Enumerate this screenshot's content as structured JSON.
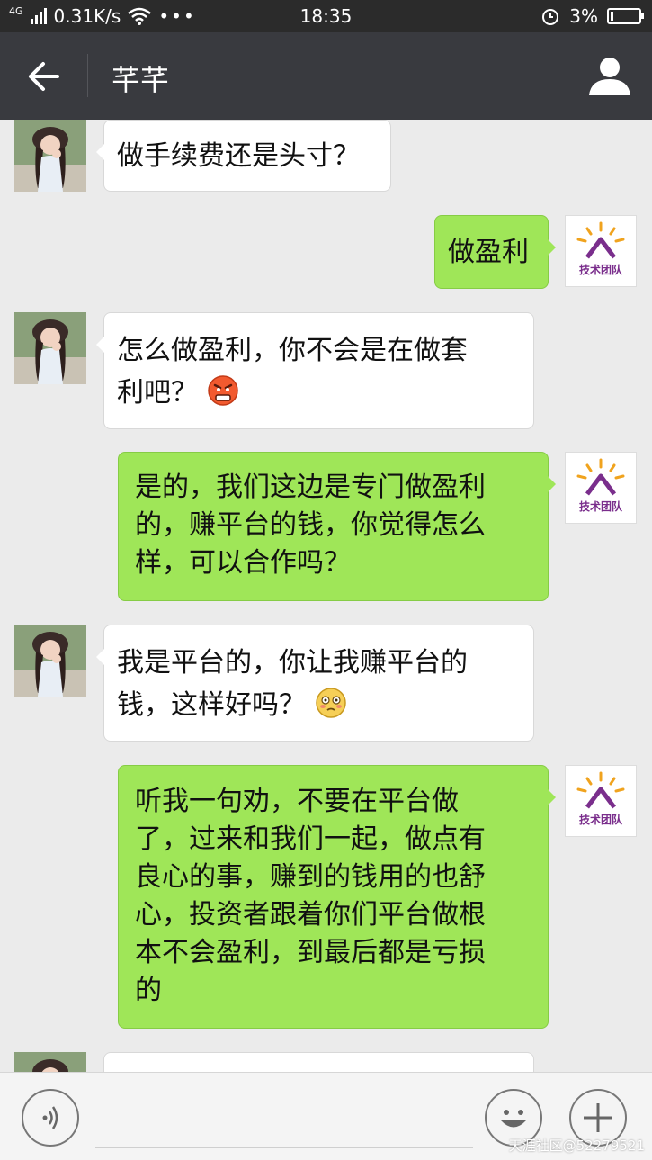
{
  "status_bar": {
    "network": "4G",
    "speed": "0.31K/s",
    "more": "•••",
    "time": "18:35",
    "battery": "3%"
  },
  "header": {
    "title": "芊芊"
  },
  "messages": [
    {
      "side": "in",
      "text": "做手续费还是头寸？"
    },
    {
      "side": "out",
      "text": "做盈利"
    },
    {
      "side": "in",
      "lines": [
        "怎么做盈利，你不会是在做套",
        "利吧？"
      ],
      "emoji": "angry-face"
    },
    {
      "side": "out",
      "lines": [
        "是的，我们这边是专门做盈利",
        "的，赚平台的钱，你觉得怎么",
        "样，可以合作吗？"
      ]
    },
    {
      "side": "in",
      "lines": [
        "我是平台的，你让我赚平台的",
        "钱，这样好吗？"
      ],
      "emoji": "flushed-face"
    },
    {
      "side": "out",
      "lines": [
        "听我一句劝，不要在平台做",
        "了，过来和我们一起，做点有",
        "良心的事，赚到的钱用的也舒",
        "心，投资者跟着你们平台做根",
        "本不会盈利，到最后都是亏损",
        "的"
      ]
    }
  ],
  "team_logo": "技术团队",
  "colors": {
    "header_bg": "#393a3f",
    "status_bg": "#2b2b2b",
    "chat_bg": "#ebebeb",
    "outgoing_bubble": "#9fe658",
    "incoming_bubble": "#ffffff"
  },
  "watermark": "天涯社区@52279521"
}
